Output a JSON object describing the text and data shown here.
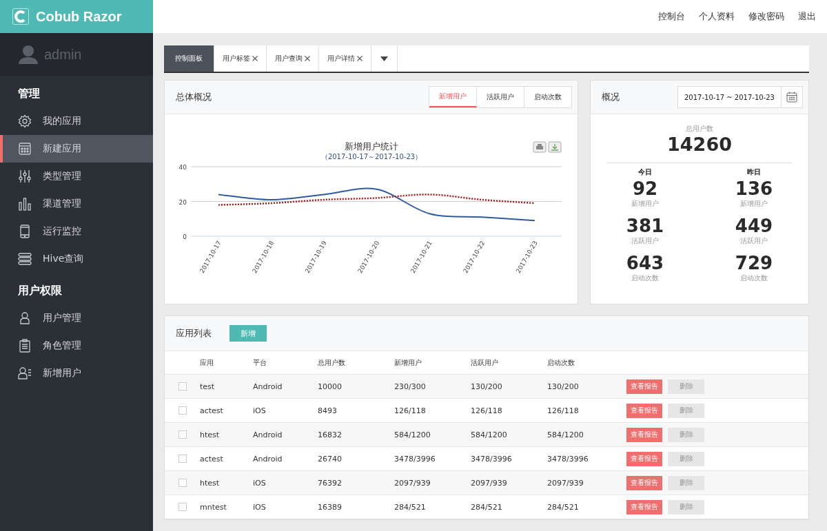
{
  "brand": {
    "name": "Cobub Razor"
  },
  "user": {
    "name": "admin"
  },
  "sidebar": {
    "sections": [
      {
        "title": "管理",
        "items": [
          {
            "label": "我的应用",
            "selected": false
          },
          {
            "label": "新建应用",
            "selected": true
          },
          {
            "label": "类型管理",
            "selected": false
          },
          {
            "label": "渠道管理",
            "selected": false
          },
          {
            "label": "运行监控",
            "selected": false
          },
          {
            "label": "Hive查询",
            "selected": false
          }
        ]
      },
      {
        "title": "用户权限",
        "items": [
          {
            "label": "用户管理",
            "selected": false
          },
          {
            "label": "角色管理",
            "selected": false
          },
          {
            "label": "新增用户",
            "selected": false
          }
        ]
      }
    ]
  },
  "top_nav": [
    "控制台",
    "个人资料",
    "修改密码",
    "退出"
  ],
  "tabs": [
    {
      "label": "控制面板",
      "selected": true,
      "closable": false
    },
    {
      "label": "用户标签",
      "selected": false,
      "closable": true
    },
    {
      "label": "用户查询",
      "selected": false,
      "closable": true
    },
    {
      "label": "用户详情",
      "selected": false,
      "closable": true
    }
  ],
  "overview_panel": {
    "title": "总体概况",
    "segments": [
      {
        "label": "新增用户",
        "selected": true
      },
      {
        "label": "活跃用户",
        "selected": false
      },
      {
        "label": "启动次数",
        "selected": false
      }
    ],
    "chart_data": {
      "type": "line",
      "title": "新增用户统计",
      "subtitle": "（2017-10-17～2017-10-23）",
      "categories": [
        "2017-10-17",
        "2017-10-18",
        "2017-10-19",
        "2017-10-20",
        "2017-10-21",
        "2017-10-22",
        "2017-10-23"
      ],
      "ylim": [
        0,
        40
      ],
      "yticks": [
        0,
        20,
        40
      ],
      "series": [
        {
          "color": "#2d5aa0",
          "line_style": "solid",
          "values": [
            24,
            21,
            24,
            27,
            13,
            11,
            9
          ]
        },
        {
          "color": "#a01c1c",
          "line_style": "dotted",
          "values": [
            18,
            19,
            21,
            22,
            24,
            21,
            19
          ]
        }
      ]
    }
  },
  "summary_panel": {
    "title": "概况",
    "date_range": "2017-10-17 ~ 2017-10-23",
    "total_label": "总用户数",
    "total": "14260",
    "columns": [
      {
        "heading": "今日",
        "stats": [
          {
            "value": "92",
            "label": "新增用户"
          },
          {
            "value": "381",
            "label": "活跃用户"
          },
          {
            "value": "643",
            "label": "启动次数"
          }
        ]
      },
      {
        "heading": "昨日",
        "stats": [
          {
            "value": "136",
            "label": "新增用户"
          },
          {
            "value": "449",
            "label": "活跃用户"
          },
          {
            "value": "729",
            "label": "启动次数"
          }
        ]
      }
    ]
  },
  "app_list": {
    "title": "应用列表",
    "add_button": "新增",
    "columns": [
      "应用",
      "平台",
      "总用户数",
      "新增用户",
      "活跃用户",
      "启动次数"
    ],
    "rows": [
      {
        "checked": false,
        "cells": [
          "test",
          "Android",
          "10000",
          "230/300",
          "130/200",
          "130/200"
        ],
        "report_button": "查看报告",
        "delete_button": "删除"
      },
      {
        "checked": false,
        "cells": [
          "actest",
          "iOS",
          "8493",
          "126/118",
          "126/118",
          "126/118"
        ],
        "report_button": "查看报告",
        "delete_button": "删除"
      },
      {
        "checked": false,
        "cells": [
          "htest",
          "Android",
          "16832",
          "584/1200",
          "584/1200",
          "584/1200"
        ],
        "report_button": "查看报告",
        "delete_button": "删除"
      },
      {
        "checked": false,
        "cells": [
          "actest",
          "Android",
          "26740",
          "3478/3996",
          "3478/3996",
          "3478/3996"
        ],
        "report_button": "查看报告",
        "delete_button": "删除"
      },
      {
        "checked": false,
        "cells": [
          "htest",
          "iOS",
          "76392",
          "2097/939",
          "2097/939",
          "2097/939"
        ],
        "report_button": "查看报告",
        "delete_button": "删除"
      },
      {
        "checked": false,
        "cells": [
          "mntest",
          "iOS",
          "16389",
          "284/521",
          "284/521",
          "284/521"
        ],
        "report_button": "查看报告",
        "delete_button": "删除"
      }
    ]
  }
}
